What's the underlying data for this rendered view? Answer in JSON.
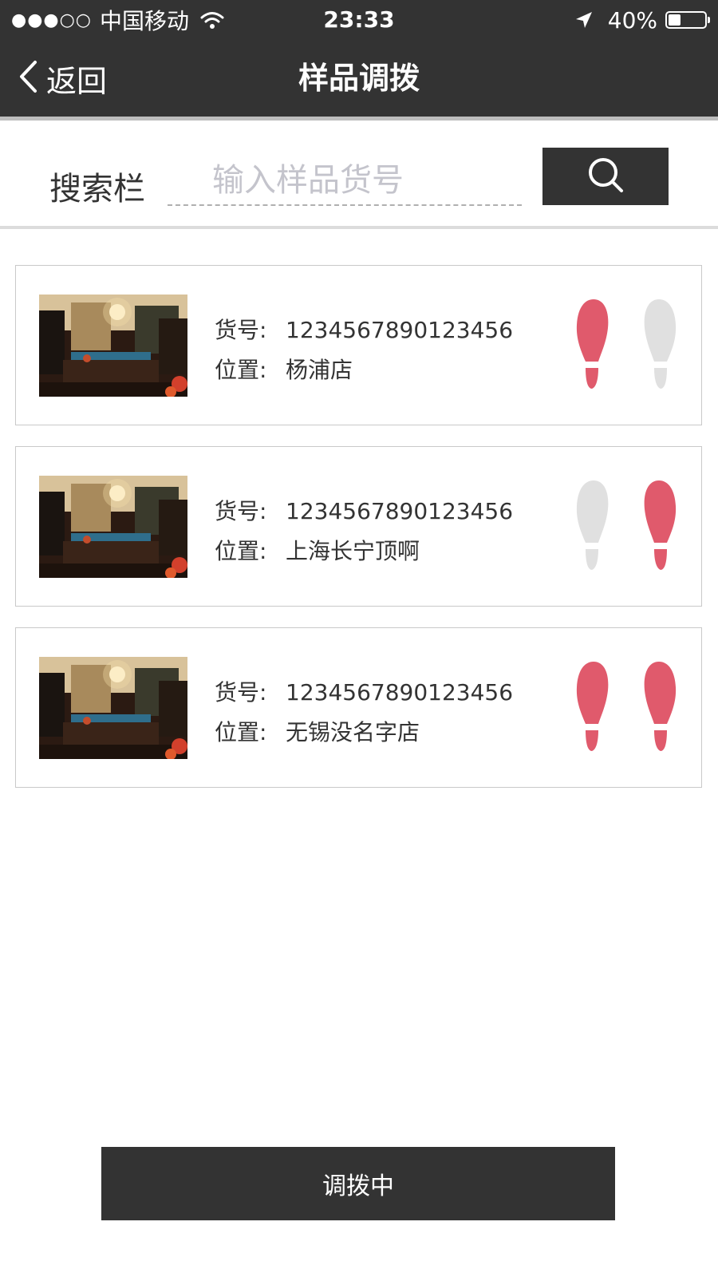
{
  "status_bar": {
    "signal": "●●●○○",
    "carrier": "中国移动",
    "time": "23:33",
    "battery": "40%",
    "battery_level": 0.4,
    "icons": [
      "wifi-icon",
      "location-arrow-icon",
      "battery-icon"
    ]
  },
  "nav": {
    "back_label": "返回",
    "title": "样品调拨"
  },
  "search": {
    "label": "搜索栏",
    "placeholder": "输入样品货号",
    "value": "",
    "button_icon": "search-icon"
  },
  "items": [
    {
      "code_label": "货号:",
      "code": "1234567890123456",
      "location_label": "位置:",
      "location": "杨浦店",
      "left_foot_active": true,
      "right_foot_active": false
    },
    {
      "code_label": "货号:",
      "code": "1234567890123456",
      "location_label": "位置:",
      "location": "上海长宁顶啊",
      "left_foot_active": false,
      "right_foot_active": true
    },
    {
      "code_label": "货号:",
      "code": "1234567890123456",
      "location_label": "位置:",
      "location": "无锡没名字店",
      "left_foot_active": true,
      "right_foot_active": true
    }
  ],
  "bottom_button": {
    "label": "调拨中"
  },
  "colors": {
    "dark": "#333333",
    "foot_active": "#e05a6c",
    "foot_inactive": "#e0e0e0"
  }
}
